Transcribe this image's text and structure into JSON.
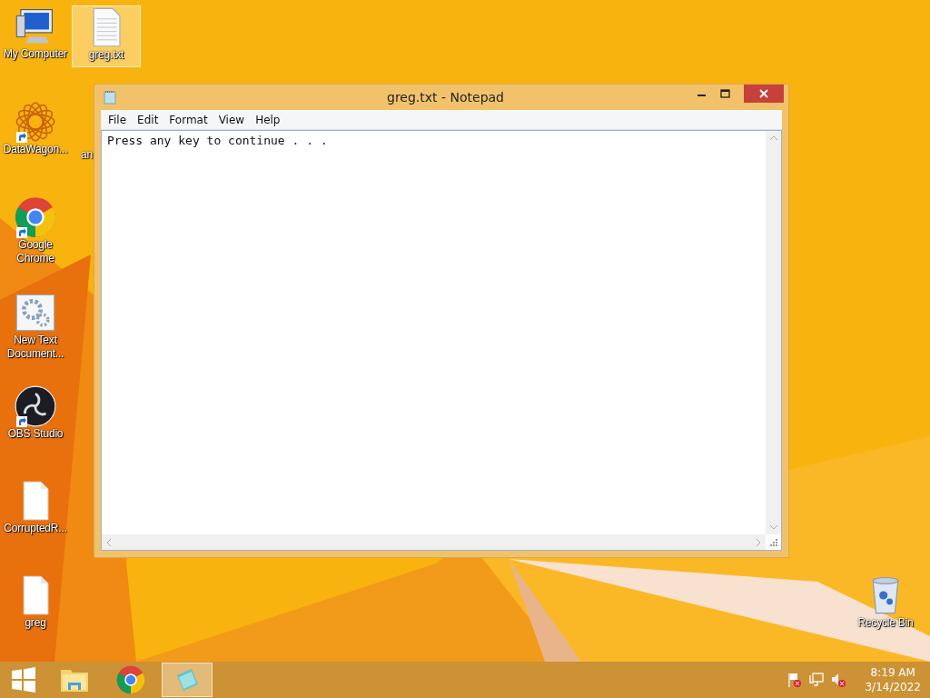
{
  "desktop": {
    "covered_label": "an",
    "icons": [
      {
        "label": "My Computer",
        "kind": "computer",
        "shortcut": false,
        "selected": false
      },
      {
        "label": "greg.txt",
        "kind": "notepad-file",
        "shortcut": false,
        "selected": true
      },
      {
        "label": "DataWagon...",
        "kind": "star",
        "shortcut": true,
        "selected": false
      },
      {
        "label": "Google Chrome",
        "kind": "chrome",
        "shortcut": true,
        "selected": false
      },
      {
        "label": "New Text Document...",
        "kind": "gear",
        "shortcut": false,
        "selected": false
      },
      {
        "label": "OBS Studio",
        "kind": "obs",
        "shortcut": true,
        "selected": false
      },
      {
        "label": "CorruptedR...",
        "kind": "blank",
        "shortcut": false,
        "selected": false
      },
      {
        "label": "greg",
        "kind": "blank",
        "shortcut": false,
        "selected": false
      },
      {
        "label": "Recycle Bin",
        "kind": "recycle",
        "shortcut": false,
        "selected": false
      }
    ]
  },
  "window": {
    "title": "greg.txt - Notepad",
    "menu": [
      "File",
      "Edit",
      "Format",
      "View",
      "Help"
    ],
    "text": "Press any key to continue . . ."
  },
  "taskbar": {
    "apps": [
      {
        "kind": "explorer",
        "selected": false
      },
      {
        "kind": "chrome",
        "selected": false
      },
      {
        "kind": "notepad",
        "selected": true
      }
    ],
    "tray": [
      {
        "kind": "flag"
      },
      {
        "kind": "network"
      },
      {
        "kind": "volume"
      }
    ],
    "time": "8:19 AM",
    "date": "3/14/2022"
  }
}
